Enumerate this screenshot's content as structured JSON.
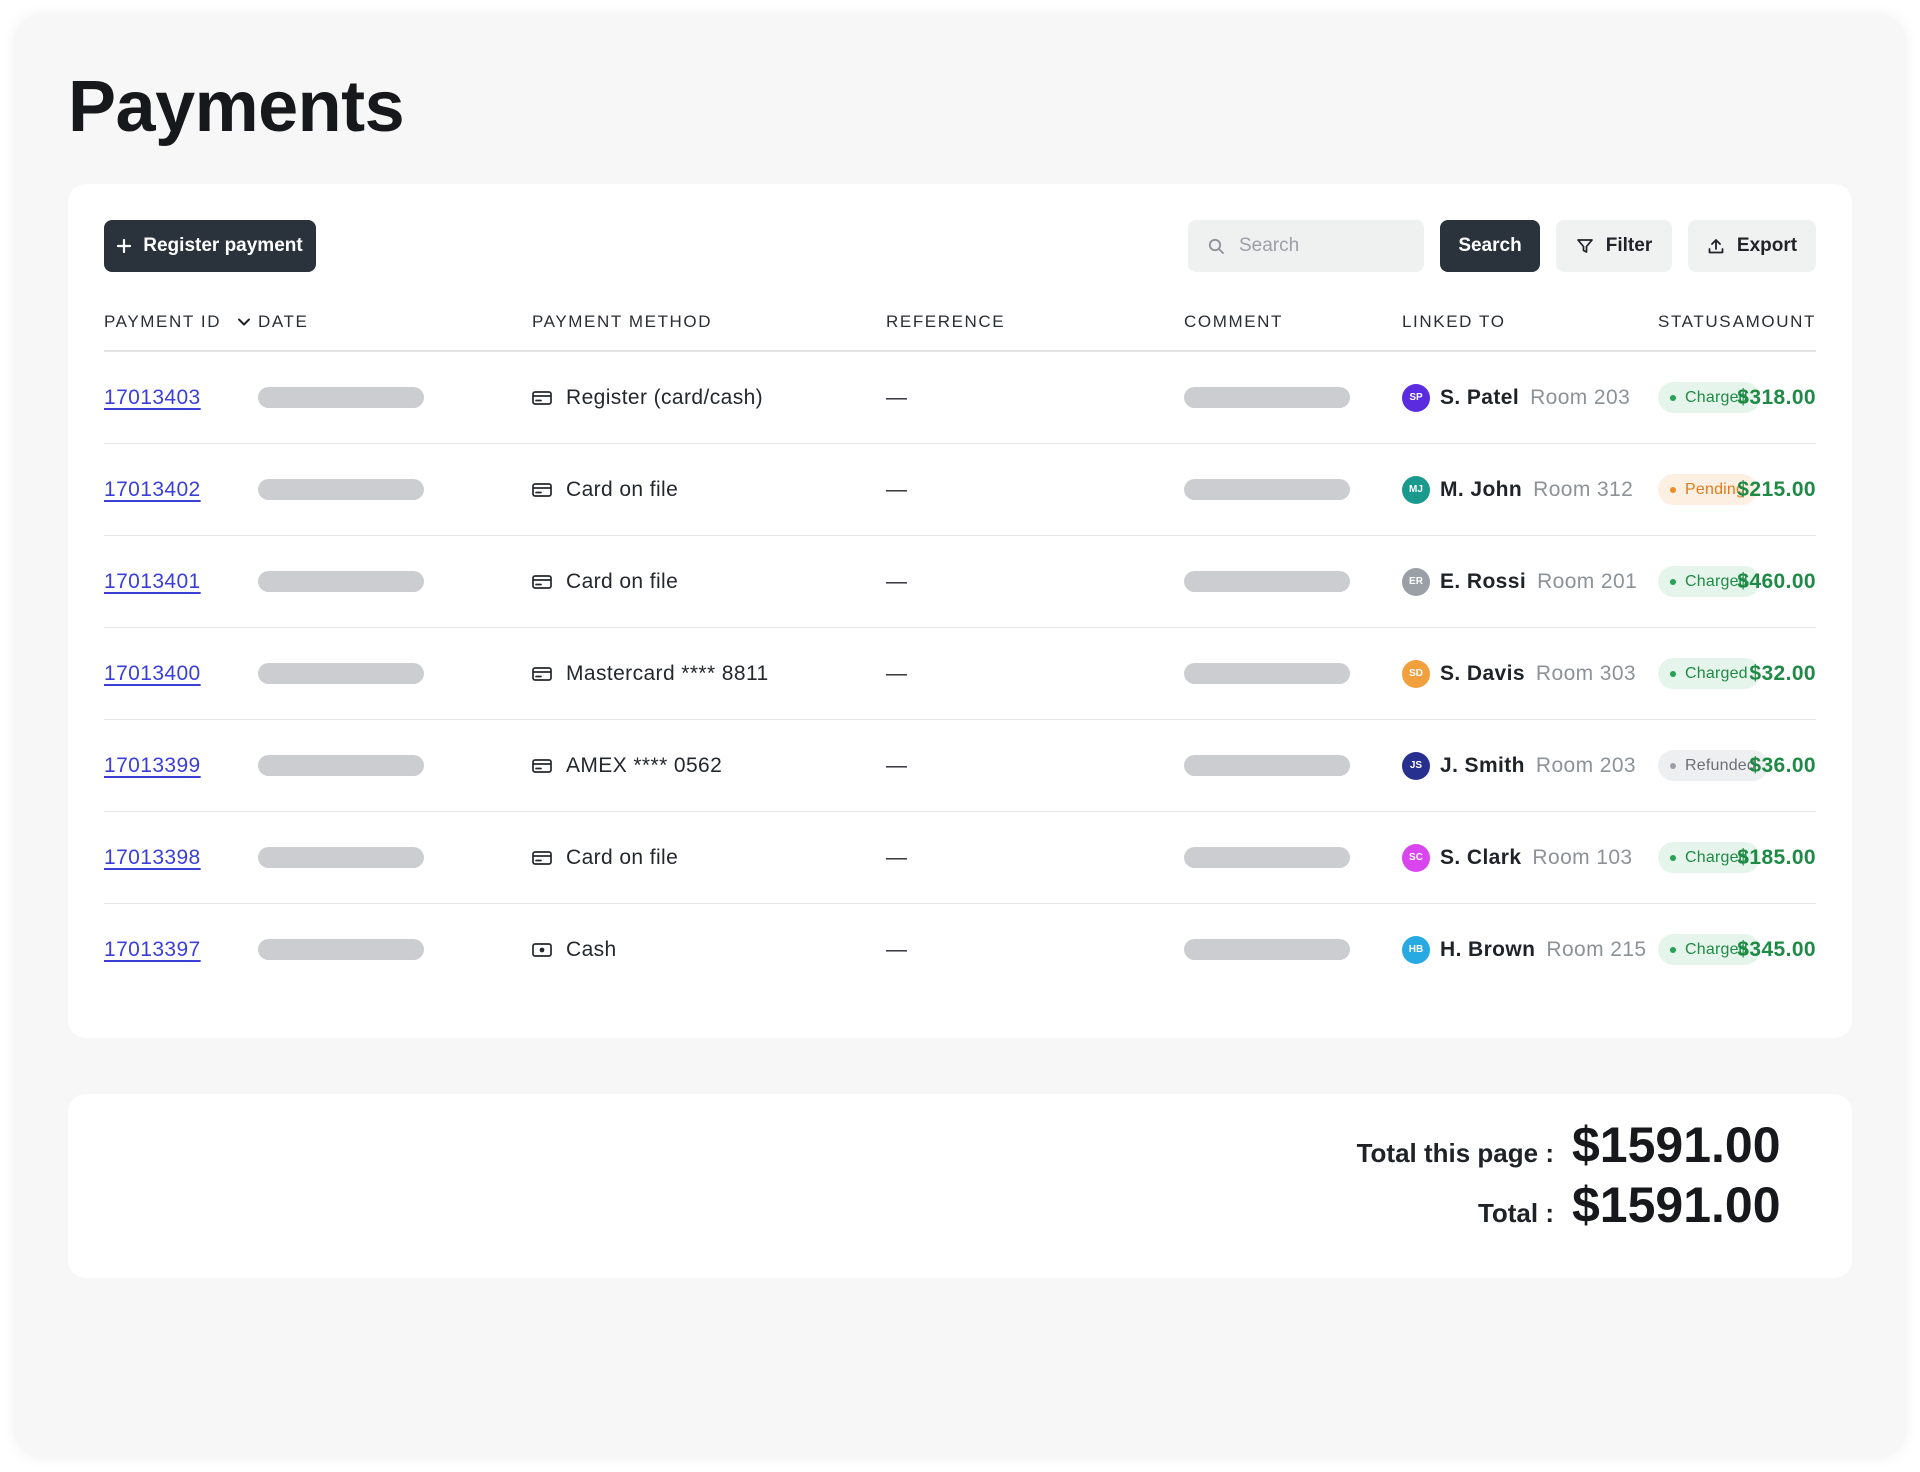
{
  "page": {
    "title": "Payments"
  },
  "toolbar": {
    "register_label": "Register payment",
    "search_placeholder": "Search",
    "search_value": "",
    "search_button": "Search",
    "filter_label": "Filter",
    "export_label": "Export"
  },
  "table": {
    "headers": {
      "payment_id": "PAYMENT ID",
      "date": "DATE",
      "payment_method": "PAYMENT METHOD",
      "reference": "REFERENCE",
      "comment": "COMMENT",
      "linked_to": "LINKED TO",
      "status": "STATUS",
      "amount": "AMOUNT"
    },
    "rows": [
      {
        "id": "17013403",
        "method": "Register (card/cash)",
        "method_icon": "card-icon",
        "reference": "—",
        "initials": "SP",
        "avatar_color": "#5b2be0",
        "guest": "S. Patel",
        "room": "Room 203",
        "status": "Charged",
        "amount": "$318.00"
      },
      {
        "id": "17013402",
        "method": "Card on file",
        "method_icon": "card-icon",
        "reference": "—",
        "initials": "MJ",
        "avatar_color": "#1a9a8f",
        "guest": "M. John",
        "room": "Room 312",
        "status": "Pending",
        "amount": "$215.00"
      },
      {
        "id": "17013401",
        "method": "Card on file",
        "method_icon": "card-icon",
        "reference": "—",
        "initials": "ER",
        "avatar_color": "#9aa0a6",
        "guest": "E. Rossi",
        "room": "Room 201",
        "status": "Charged",
        "amount": "$460.00"
      },
      {
        "id": "17013400",
        "method": "Mastercard **** 8811",
        "method_icon": "card-icon",
        "reference": "—",
        "initials": "SD",
        "avatar_color": "#f2a03d",
        "guest": "S. Davis",
        "room": "Room 303",
        "status": "Charged",
        "amount": "$32.00"
      },
      {
        "id": "17013399",
        "method": "AMEX **** 0562",
        "method_icon": "card-icon",
        "reference": "—",
        "initials": "JS",
        "avatar_color": "#27308f",
        "guest": "J. Smith",
        "room": "Room 203",
        "status": "Refunded",
        "amount": "$36.00"
      },
      {
        "id": "17013398",
        "method": "Card on file",
        "method_icon": "card-icon",
        "reference": "—",
        "initials": "SC",
        "avatar_color": "#d946ef",
        "guest": "S. Clark",
        "room": "Room 103",
        "status": "Charged",
        "amount": "$185.00"
      },
      {
        "id": "17013397",
        "method": "Cash",
        "method_icon": "cash-icon",
        "reference": "—",
        "initials": "HB",
        "avatar_color": "#27a9e1",
        "guest": "H. Brown",
        "room": "Room 215",
        "status": "Charged",
        "amount": "$345.00"
      }
    ]
  },
  "status_colors": {
    "Charged": {
      "bg": "#e6f5ec",
      "fg": "#1e8a45",
      "dot": "#22a353"
    },
    "Pending": {
      "bg": "#fdf0e3",
      "fg": "#e07b1a",
      "dot": "#f08c22"
    },
    "Refunded": {
      "bg": "#eeeff0",
      "fg": "#6b7076",
      "dot": "#9aa0a6"
    }
  },
  "totals": {
    "page_label": "Total this page :",
    "page_value": "$1591.00",
    "total_label": "Total :",
    "total_value": "$1591.00"
  }
}
